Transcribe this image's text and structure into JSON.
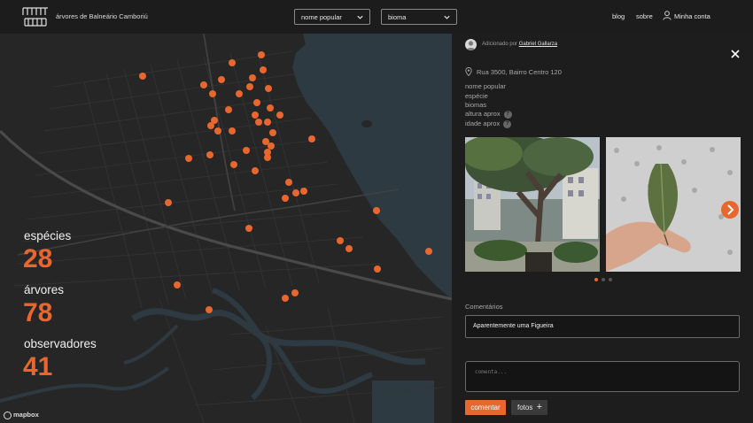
{
  "header": {
    "brand": "árvores de Balneário Camboriú",
    "filter_species": "nome popular",
    "filter_biome": "bioma",
    "nav_blog": "blog",
    "nav_about": "sobre",
    "nav_account": "Minha conta"
  },
  "stats": {
    "species_label": "espécies",
    "species_value": "28",
    "trees_label": "árvores",
    "trees_value": "78",
    "observers_label": "observadores",
    "observers_value": "41"
  },
  "map": {
    "attribution": "mapbox",
    "marker_color": "#e8672f",
    "water_color": "#2e3a42",
    "land_color": "#262626",
    "road_color": "#3a3a3a"
  },
  "panel": {
    "added_by_prefix": "Adicionado por",
    "added_by_name": "Gabriel Gallarza",
    "address": "Rua 3500, Bairro Centro 120",
    "field_common_name": "nome popular",
    "field_species": "espécie",
    "field_biomes": "biomas",
    "field_height": "altura aprox",
    "field_age": "idade aprox",
    "help_glyph": "?",
    "comments_title": "Comentários",
    "comment_1": "Aparentemente uma Figueira",
    "comment_placeholder": "comenta...",
    "btn_comment": "comentar",
    "btn_photos": "fotos",
    "btn_photos_plus": "+",
    "carousel_index": 1,
    "carousel_total": 3
  }
}
